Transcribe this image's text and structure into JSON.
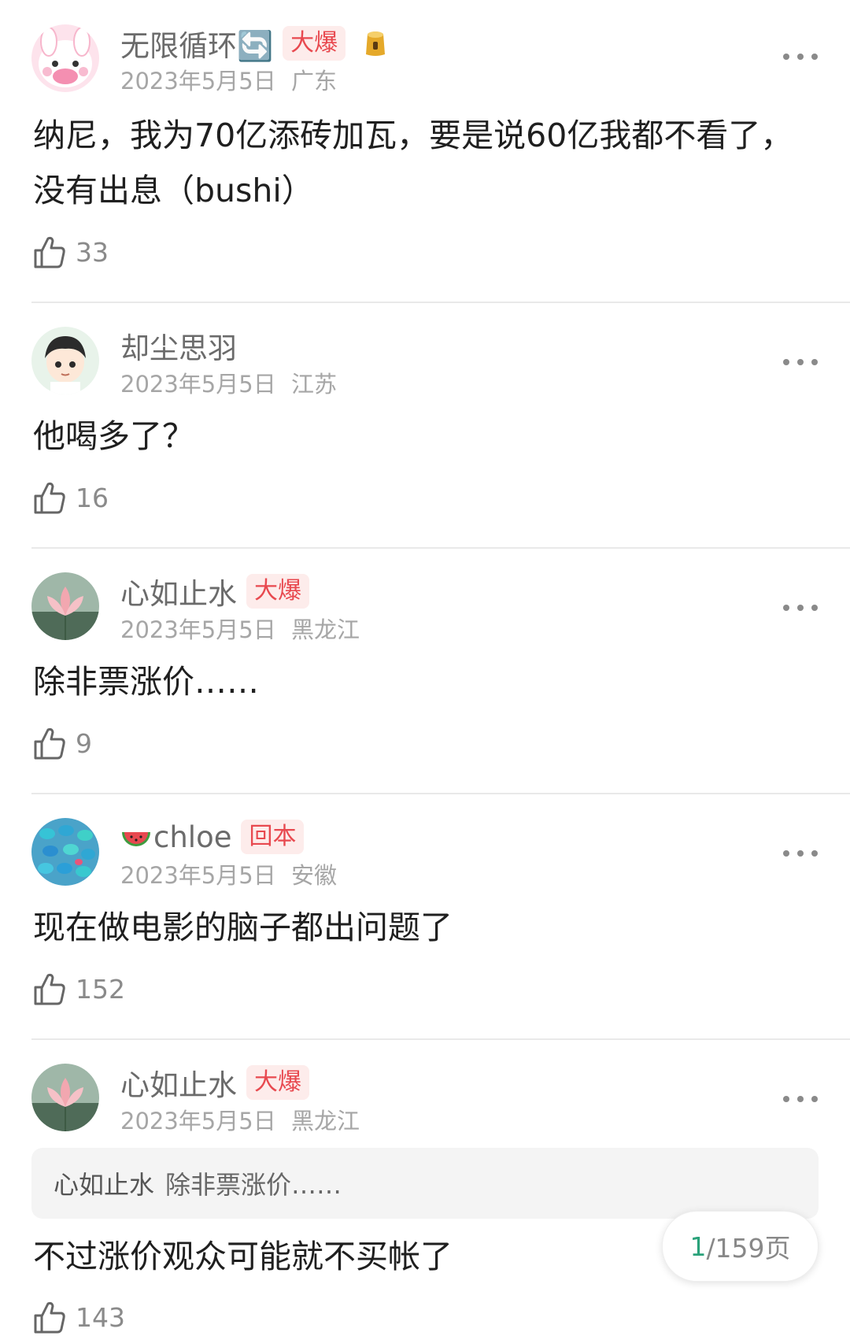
{
  "comments": [
    {
      "username": "无限循环🔄",
      "badge": "大爆",
      "date": "2023年5月5日",
      "region": "广东",
      "text_line1": "纳尼，我为70亿添砖加瓦，要是说60亿我都不看了，",
      "text_line2": "没有出息（bushi）",
      "likes": "33",
      "avatar_icon": "pink-bunny-avatar"
    },
    {
      "username": "却尘思羽",
      "date": "2023年5月5日",
      "region": "江苏",
      "text": "他喝多了？",
      "likes": "16",
      "avatar_icon": "cartoon-boy-avatar"
    },
    {
      "username": "心如止水",
      "badge": "大爆",
      "date": "2023年5月5日",
      "region": "黑龙江",
      "text": "除非票涨价……",
      "likes": "9",
      "avatar_icon": "lotus-avatar"
    },
    {
      "username": "chloe",
      "badge": "回本",
      "date": "2023年5月5日",
      "region": "安徽",
      "text": "现在做电影的脑子都出问题了",
      "likes": "152",
      "avatar_icon": "blue-candies-avatar"
    },
    {
      "username": "心如止水",
      "badge": "大爆",
      "date": "2023年5月5日",
      "region": "黑龙江",
      "quote_name": "心如止水",
      "quote_text": "除非票涨价……",
      "text": "不过涨价观众可能就不买帐了",
      "likes": "143",
      "avatar_icon": "lotus-avatar"
    }
  ],
  "pager": {
    "current": "1",
    "total_suffix": "/159页"
  },
  "colors": {
    "badge_bg": "#fdeceb",
    "badge_text": "#e8494f",
    "pager_current": "#2aa27a"
  }
}
